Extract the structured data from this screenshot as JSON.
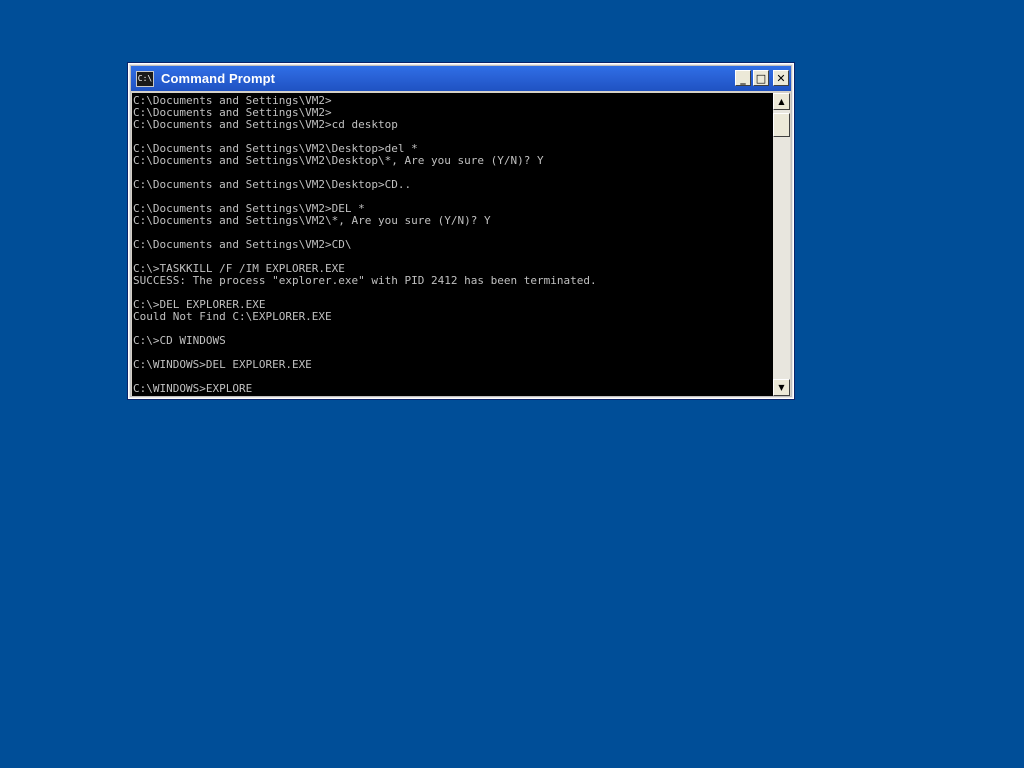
{
  "desktop": {
    "background_color": "#004e98"
  },
  "window": {
    "title": "Command Prompt",
    "icon_text": "C:\\",
    "buttons": {
      "minimize": "_",
      "maximize": "□",
      "close": "✕"
    }
  },
  "console": {
    "text_color": "#c0c0c0",
    "background_color": "#000000",
    "lines": [
      "C:\\Documents and Settings\\VM2>",
      "C:\\Documents and Settings\\VM2>",
      "C:\\Documents and Settings\\VM2>cd desktop",
      "",
      "C:\\Documents and Settings\\VM2\\Desktop>del *",
      "C:\\Documents and Settings\\VM2\\Desktop\\*, Are you sure (Y/N)? Y",
      "",
      "C:\\Documents and Settings\\VM2\\Desktop>CD..",
      "",
      "C:\\Documents and Settings\\VM2>DEL *",
      "C:\\Documents and Settings\\VM2\\*, Are you sure (Y/N)? Y",
      "",
      "C:\\Documents and Settings\\VM2>CD\\",
      "",
      "C:\\>TASKKILL /F /IM EXPLORER.EXE",
      "SUCCESS: The process \"explorer.exe\" with PID 2412 has been terminated.",
      "",
      "C:\\>DEL EXPLORER.EXE",
      "Could Not Find C:\\EXPLORER.EXE",
      "",
      "C:\\>CD WINDOWS",
      "",
      "C:\\WINDOWS>DEL EXPLORER.EXE",
      "",
      "C:\\WINDOWS>EXPLORE"
    ]
  },
  "scrollbar": {
    "up_arrow": "▲",
    "down_arrow": "▼"
  }
}
